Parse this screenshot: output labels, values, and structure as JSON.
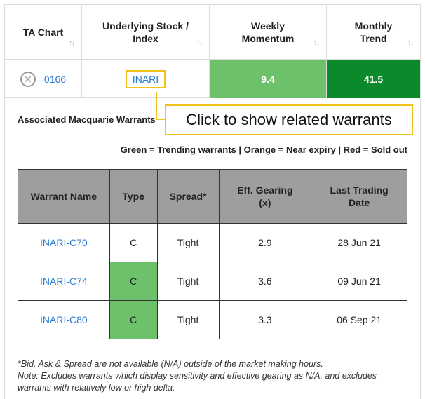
{
  "header": {
    "columns": [
      {
        "label_line1": "TA Chart",
        "label_line2": ""
      },
      {
        "label_line1": "Underlying Stock /",
        "label_line2": "Index"
      },
      {
        "label_line1": "Weekly",
        "label_line2": "Momentum"
      },
      {
        "label_line1": "Monthly",
        "label_line2": "Trend"
      }
    ],
    "sort_glyph": "↑↓"
  },
  "row": {
    "remove_glyph": "✕",
    "code": "0166",
    "underlying": "INARI",
    "weekly_momentum": "9.4",
    "monthly_trend": "41.5"
  },
  "callout": {
    "text": "Click to show related warrants"
  },
  "section": {
    "title": "Associated Macquarie Warrants",
    "legend": "Green = Trending warrants | Orange = Near expiry | Red = Sold out"
  },
  "warrant_table": {
    "headers": [
      {
        "l1": "Warrant Name",
        "l2": ""
      },
      {
        "l1": "Type",
        "l2": ""
      },
      {
        "l1": "Spread*",
        "l2": ""
      },
      {
        "l1": "Eff. Gearing",
        "l2": "(x)"
      },
      {
        "l1": "Last Trading",
        "l2": "Date"
      }
    ],
    "rows": [
      {
        "name": "INARI-C70",
        "type": "C",
        "spread": "Tight",
        "gearing": "2.9",
        "last_date": "28 Jun 21",
        "trending": false
      },
      {
        "name": "INARI-C74",
        "type": "C",
        "spread": "Tight",
        "gearing": "3.6",
        "last_date": "09 Jun 21",
        "trending": true
      },
      {
        "name": "INARI-C80",
        "type": "C",
        "spread": "Tight",
        "gearing": "3.3",
        "last_date": "06 Sep 21",
        "trending": true
      }
    ]
  },
  "footnote": {
    "line1": "*Bid, Ask & Spread are not available (N/A) outside of the market making hours.",
    "line2": "Note: Excludes warrants which display sensitivity and effective gearing as N/A, and excludes warrants with relatively low or high delta."
  },
  "colors": {
    "weekly_bg": "#6cc16a",
    "monthly_bg": "#0a8a2a",
    "trending_bg": "#6cc16a",
    "highlight": "#f2c21b",
    "link": "#2a7bd3"
  }
}
